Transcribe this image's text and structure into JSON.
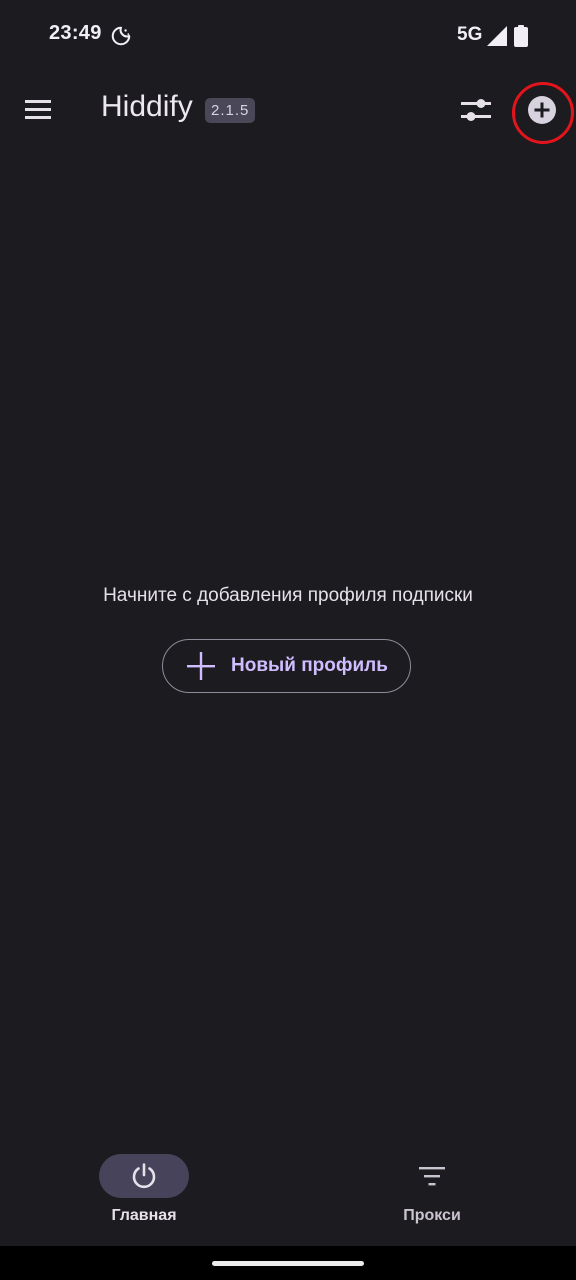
{
  "status_bar": {
    "time": "23:49",
    "network": "5G",
    "icons": [
      "moon-icon",
      "signal-icon",
      "battery-icon"
    ]
  },
  "app_bar": {
    "title": "Hiddify",
    "version": "2.1.5",
    "icons": [
      "menu-icon",
      "sliders-icon",
      "add-circle-icon"
    ]
  },
  "empty_state": {
    "message": "Начните с добавления профиля подписки",
    "button_label": "Новый профиль",
    "button_icon": "plus-icon"
  },
  "bottom_nav": {
    "items": [
      {
        "label": "Главная",
        "icon": "power-icon",
        "selected": true
      },
      {
        "label": "Прокси",
        "icon": "filter-icon",
        "selected": false
      }
    ]
  },
  "colors": {
    "background": "#1c1b20",
    "accent_text": "#cfbdff",
    "highlight_ring": "#e4141c",
    "nav_pill": "#47435a"
  }
}
